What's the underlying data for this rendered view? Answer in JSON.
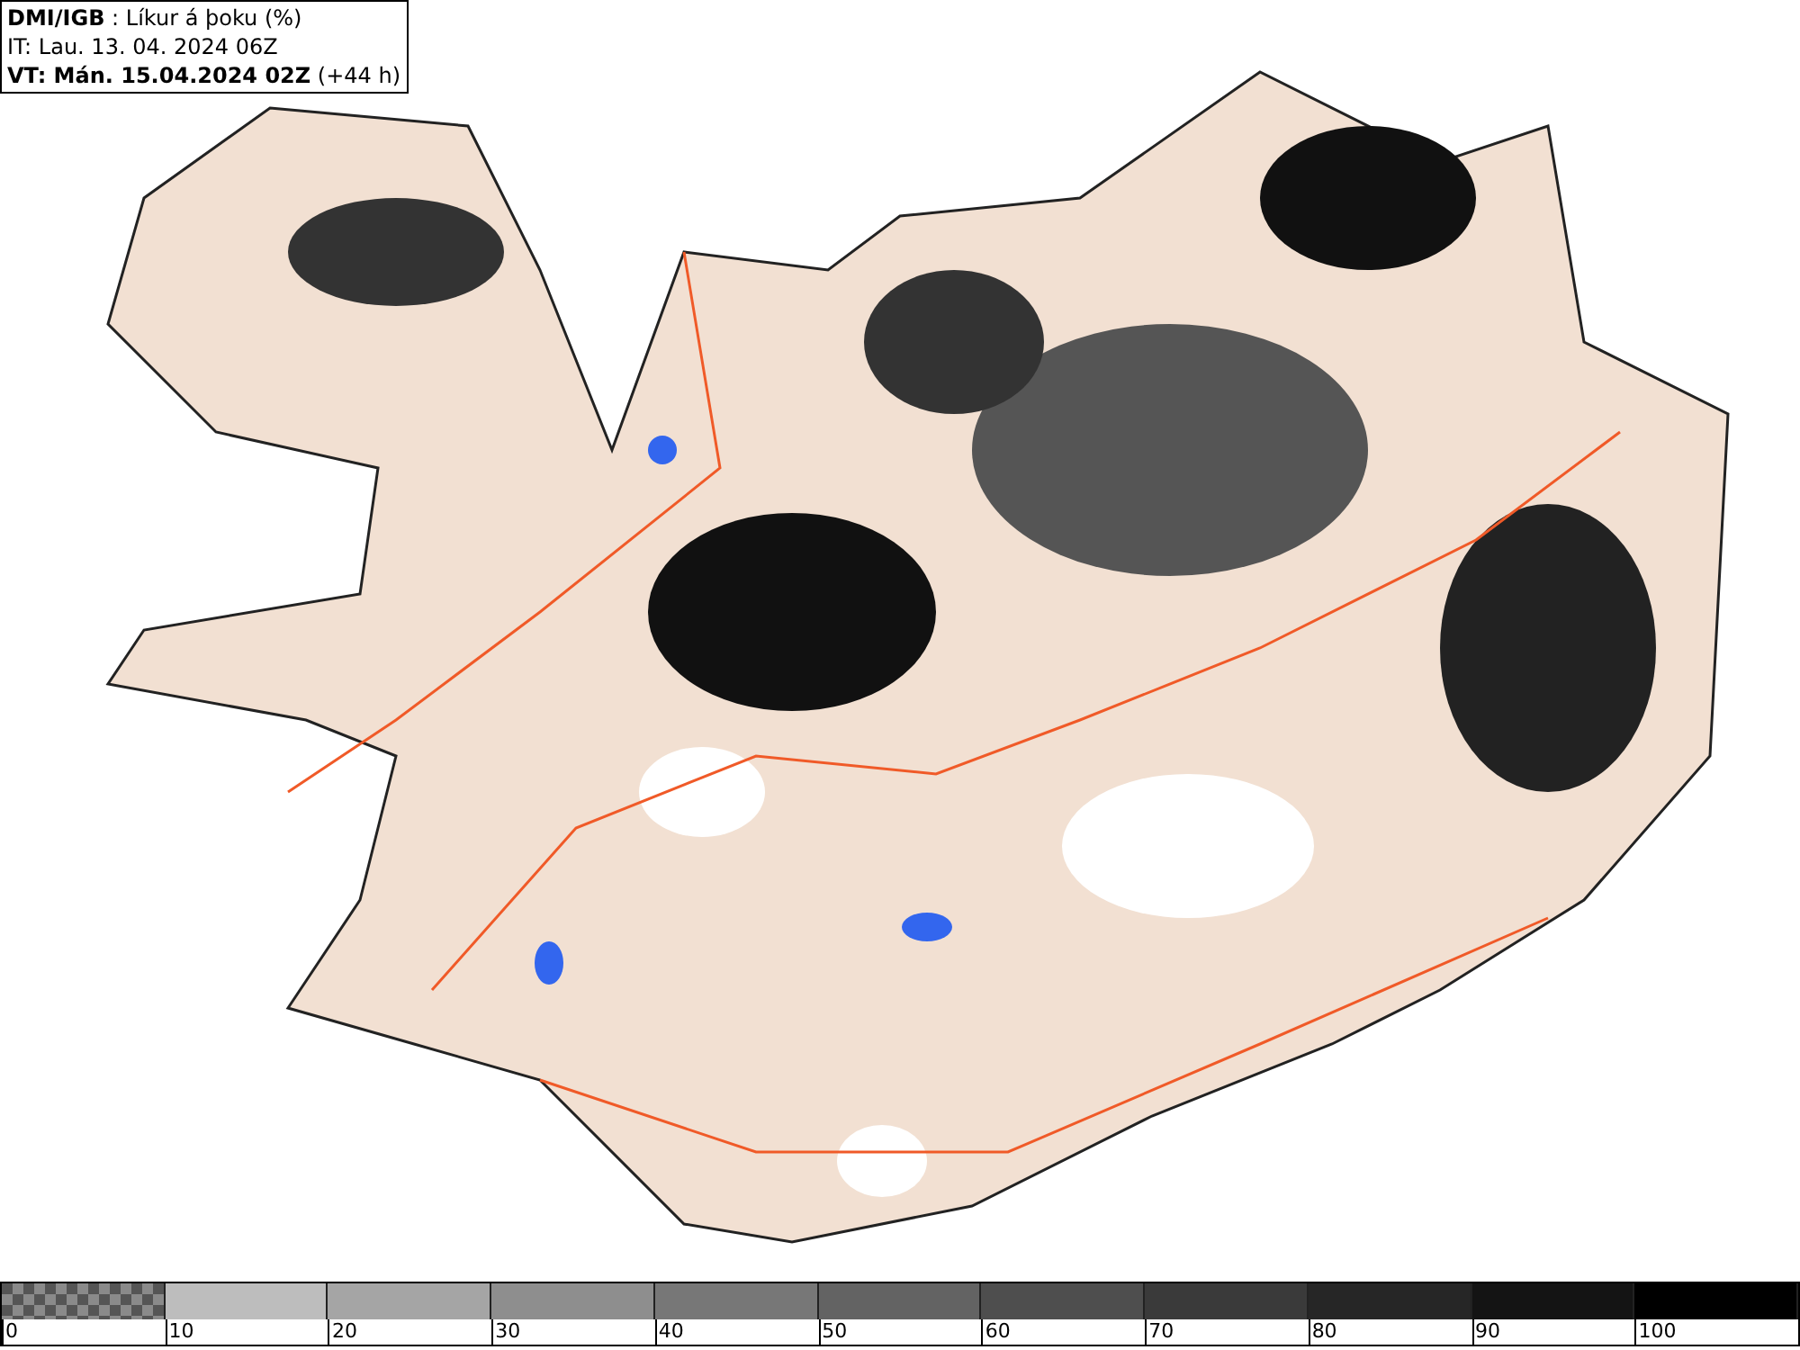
{
  "header": {
    "lines": [
      "**DMI/IGB** : Líkur á þoku (%)",
      "IT: Lau. 13. 04. 2024 06Z",
      "**VT: Mán. 15.04.2024 02Z** (+44 h)"
    ]
  },
  "legend": {
    "bins": [
      {
        "label": "0",
        "kind": "pattern"
      },
      {
        "label": "10",
        "kind": "solid",
        "color": "#bdbdbd"
      },
      {
        "label": "20",
        "kind": "solid",
        "color": "#a5a5a5"
      },
      {
        "label": "30",
        "kind": "solid",
        "color": "#8e8e8e"
      },
      {
        "label": "40",
        "kind": "solid",
        "color": "#777777"
      },
      {
        "label": "50",
        "kind": "solid",
        "color": "#636363"
      },
      {
        "label": "60",
        "kind": "solid",
        "color": "#4e4e4e"
      },
      {
        "label": "70",
        "kind": "solid",
        "color": "#3a3a3a"
      },
      {
        "label": "80",
        "kind": "solid",
        "color": "#262626"
      },
      {
        "label": "90",
        "kind": "solid",
        "color": "#141414"
      },
      {
        "label": "100",
        "kind": "solid",
        "color": "#000000"
      }
    ]
  }
}
